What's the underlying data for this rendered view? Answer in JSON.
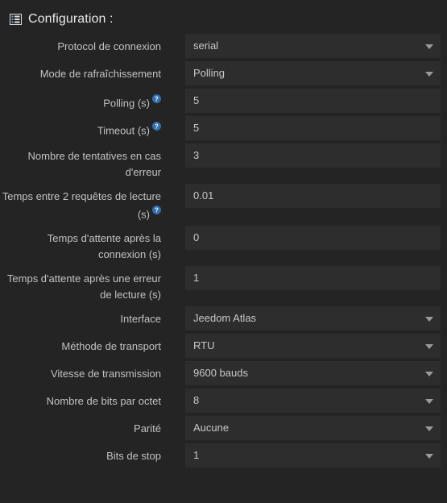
{
  "header": {
    "icon": "list-icon",
    "title": "Configuration :"
  },
  "form": {
    "rows": [
      {
        "label": "Protocol de connexion",
        "help": false,
        "type": "select",
        "value": "serial"
      },
      {
        "label": "Mode de rafraîchissement",
        "help": false,
        "type": "select",
        "value": "Polling"
      },
      {
        "label": "Polling (s)",
        "help": true,
        "type": "text",
        "value": "5"
      },
      {
        "label": "Timeout (s)",
        "help": true,
        "type": "text",
        "value": "5"
      },
      {
        "label": "Nombre de tentatives en cas d'erreur",
        "help": false,
        "type": "text",
        "value": "3"
      },
      {
        "label": "Temps entre 2 requêtes de lecture (s)",
        "help": true,
        "type": "text",
        "value": "0.01"
      },
      {
        "label": "Temps d'attente après la connexion (s)",
        "help": false,
        "type": "text",
        "value": "0"
      },
      {
        "label": "Temps d'attente après une erreur de lecture (s)",
        "help": false,
        "type": "text",
        "value": "1"
      },
      {
        "label": "Interface",
        "help": false,
        "type": "select",
        "value": "Jeedom Atlas"
      },
      {
        "label": "Méthode de transport",
        "help": false,
        "type": "select",
        "value": "RTU"
      },
      {
        "label": "Vitesse de transmission",
        "help": false,
        "type": "select",
        "value": "9600 bauds"
      },
      {
        "label": "Nombre de bits par octet",
        "help": false,
        "type": "select",
        "value": "8"
      },
      {
        "label": "Parité",
        "help": false,
        "type": "select",
        "value": "Aucune"
      },
      {
        "label": "Bits de stop",
        "help": false,
        "type": "select",
        "value": "1"
      }
    ]
  },
  "colors": {
    "background": "#242424",
    "field_background": "#2d2d2d",
    "label_text": "#c2c2c2",
    "value_text": "#c8c8c8",
    "title_text": "#e8e8e8",
    "help_icon": "#2f6fad",
    "caret": "#9a9a9a"
  }
}
